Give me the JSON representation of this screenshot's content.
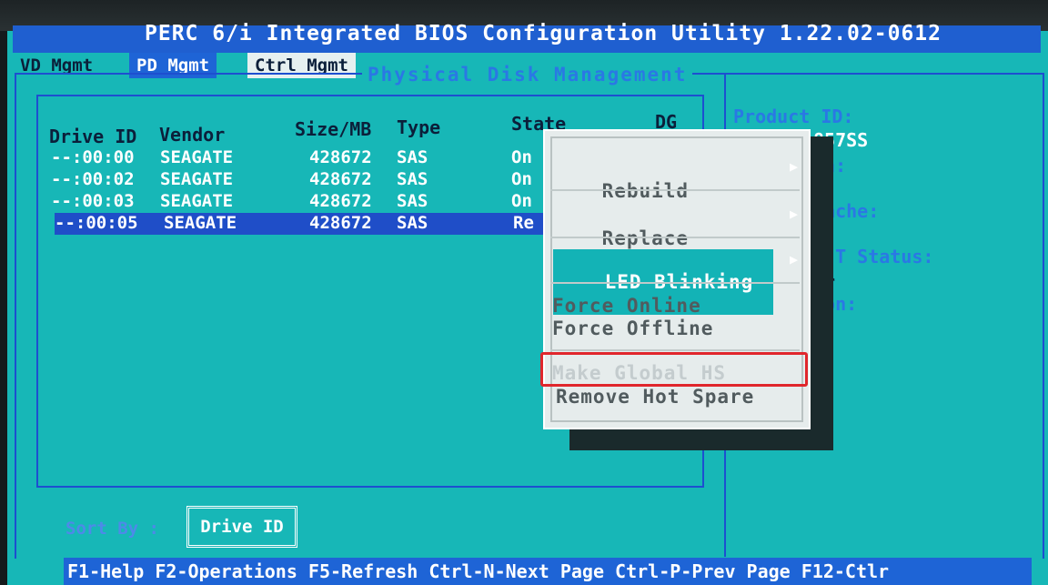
{
  "title": "PERC 6/i Integrated BIOS Configuration Utility 1.22.02-0612",
  "tabs": [
    {
      "label": "VD Mgmt"
    },
    {
      "label": "PD Mgmt"
    },
    {
      "label": "Ctrl Mgmt"
    }
  ],
  "section_title": "Physical Disk Management",
  "table": {
    "headers": {
      "drive_id": "Drive ID",
      "vendor": "Vendor",
      "size": "Size/MB",
      "type": "Type",
      "state": "State",
      "dg": "DG"
    },
    "rows": [
      {
        "drive_id": "--:00:00",
        "vendor": "SEAGATE",
        "size": "428672",
        "type": "SAS",
        "state": "On"
      },
      {
        "drive_id": "--:00:02",
        "vendor": "SEAGATE",
        "size": "428672",
        "type": "SAS",
        "state": "On"
      },
      {
        "drive_id": "--:00:03",
        "vendor": "SEAGATE",
        "size": "428672",
        "type": "SAS",
        "state": "On"
      },
      {
        "drive_id": "--:00:05",
        "vendor": "SEAGATE",
        "size": "428672",
        "type": "SAS",
        "state": "Re"
      }
    ]
  },
  "sort": {
    "label": "Sort By :",
    "value": "Drive ID"
  },
  "right_panel": {
    "product_id_label": "Product ID:",
    "product_id_value": "857SS",
    "line2": "on:",
    "line3": "Cache:",
    "line4": "R.T Status:",
    "line5": "or",
    "line6": "ion:"
  },
  "menu": {
    "rebuild": "Rebuild",
    "replace": "Replace",
    "led_blinking": "LED Blinking",
    "force_online": "Force Online",
    "force_offline": "Force Offline",
    "make_global_hs": "Make Global HS",
    "remove_hot_spare": "Remove Hot Spare"
  },
  "footer": "F1-Help F2-Operations F5-Refresh Ctrl-N-Next Page Ctrl-P-Prev Page F12-Ctlr",
  "colors": {
    "background": "#17b7b7",
    "title_bar": "#1f5fd0",
    "highlight": "#e0262c"
  }
}
